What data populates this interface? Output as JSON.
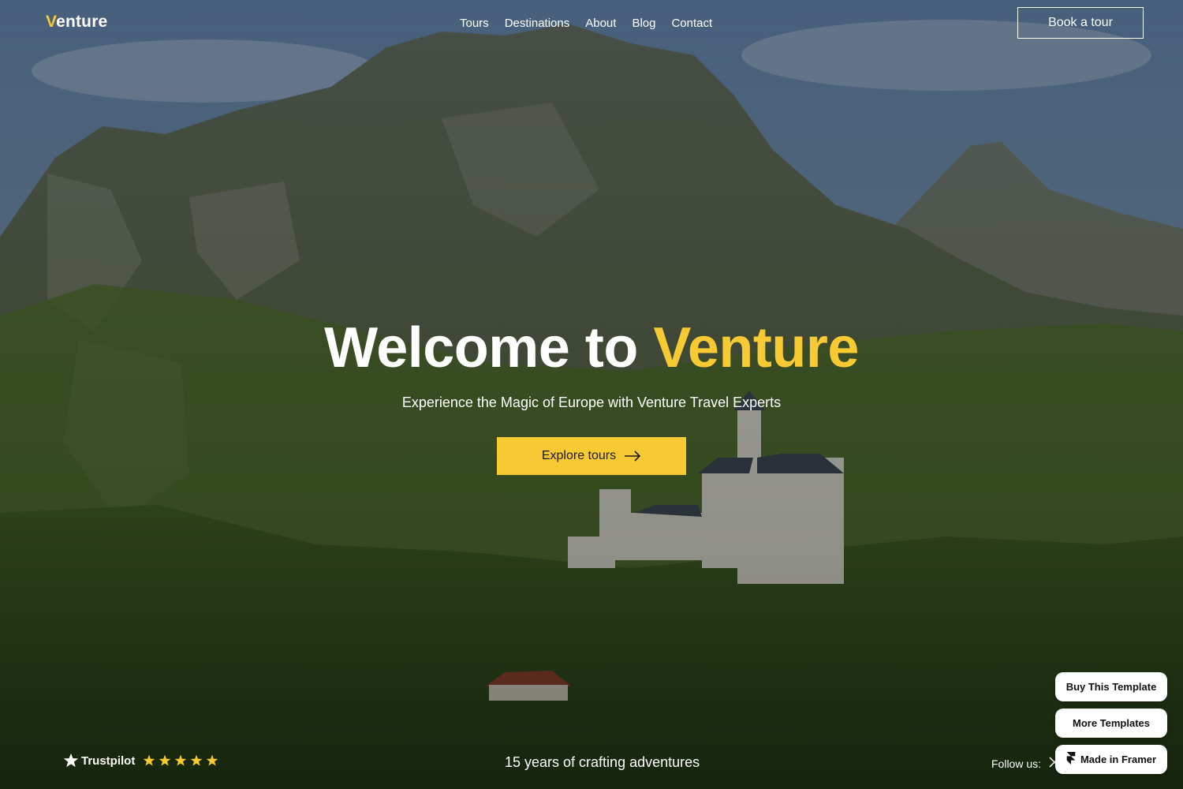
{
  "header": {
    "logo_first": "V",
    "logo_rest": "enture",
    "nav": [
      "Tours",
      "Destinations",
      "About",
      "Blog",
      "Contact"
    ],
    "book_label": "Book a tour"
  },
  "hero": {
    "title_main": "Welcome to ",
    "title_accent": "Venture",
    "subtitle": "Experience the Magic of Europe with Venture Travel Experts",
    "cta_label": "Explore tours",
    "cta_icon": "arrow-right-icon"
  },
  "footer": {
    "trustpilot_label": "Trustpilot",
    "trustpilot_rating": 5,
    "tagline": "15 years of crafting adventures",
    "follow_label": "Follow us:"
  },
  "framer": {
    "buy_label": "Buy This Template",
    "more_label": "More Templates",
    "made_label": "Made in Framer"
  },
  "colors": {
    "accent": "#f7ca34",
    "text": "#ffffff",
    "cta_text": "#1a1a1a"
  }
}
